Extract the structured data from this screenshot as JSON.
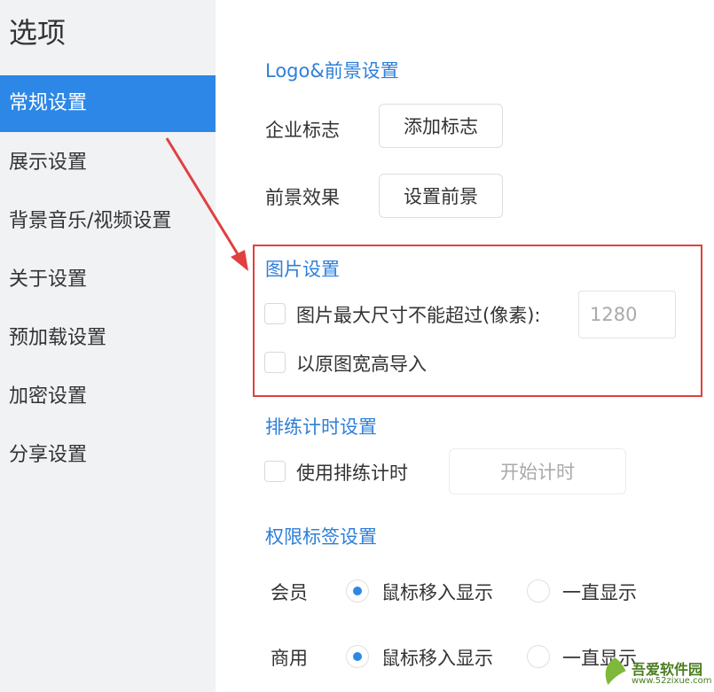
{
  "sidebar": {
    "title": "选项",
    "items": [
      {
        "label": "常规设置",
        "active": true
      },
      {
        "label": "展示设置"
      },
      {
        "label": "背景音乐/视频设置"
      },
      {
        "label": "关于设置"
      },
      {
        "label": "预加载设置"
      },
      {
        "label": "加密设置"
      },
      {
        "label": "分享设置"
      }
    ]
  },
  "logo_section": {
    "title": "Logo&前景设置",
    "logo_label": "企业标志",
    "logo_button": "添加标志",
    "fg_label": "前景效果",
    "fg_button": "设置前景"
  },
  "image_section": {
    "title": "图片设置",
    "max_size_label": "图片最大尺寸不能超过(像素):",
    "max_size_value": "1280",
    "original_label": "以原图宽高导入"
  },
  "timer_section": {
    "title": "排练计时设置",
    "use_label": "使用排练计时",
    "start_button": "开始计时"
  },
  "permission_section": {
    "title": "权限标签设置",
    "rows": [
      {
        "label": "会员",
        "opt1": "鼠标移入显示",
        "opt2": "一直显示"
      },
      {
        "label": "商用",
        "opt1": "鼠标移入显示",
        "opt2": "一直显示"
      }
    ]
  },
  "watermark": {
    "title": "吾爱软件园",
    "url": "www.52zixue.com"
  },
  "colors": {
    "accent": "#2d87e6",
    "section_title": "#2e7fd9",
    "highlight": "#e04040"
  }
}
